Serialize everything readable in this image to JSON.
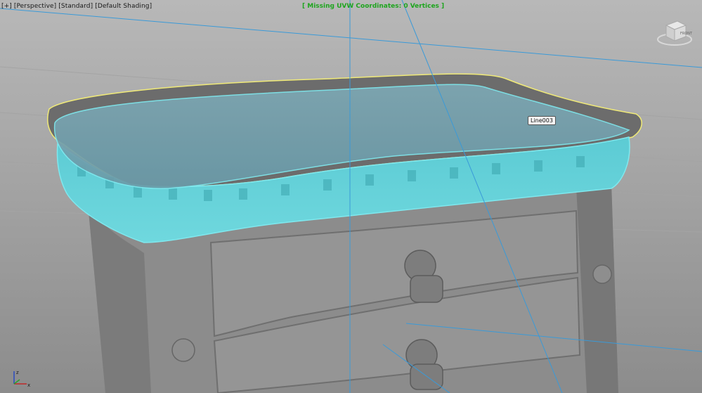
{
  "viewport": {
    "menu": {
      "plus": "[+]",
      "view": "[Perspective]",
      "mode": "[Standard]",
      "shading": "[Default Shading]"
    },
    "status_text": "[ Missing UVW Coordinates: 0 Vertices ]",
    "object_label": "Line003",
    "viewcube_label": "FRONT",
    "axis_labels": {
      "z": "z",
      "x": "x"
    }
  },
  "colors": {
    "selection_wire": "#7fe8ee",
    "object_highlight": "#f0ea78",
    "status_green": "#1ea51e",
    "construction_line": "#3a9ad8",
    "body_gray": "#8a8a8a",
    "top_fill": "#5fb7c4"
  }
}
